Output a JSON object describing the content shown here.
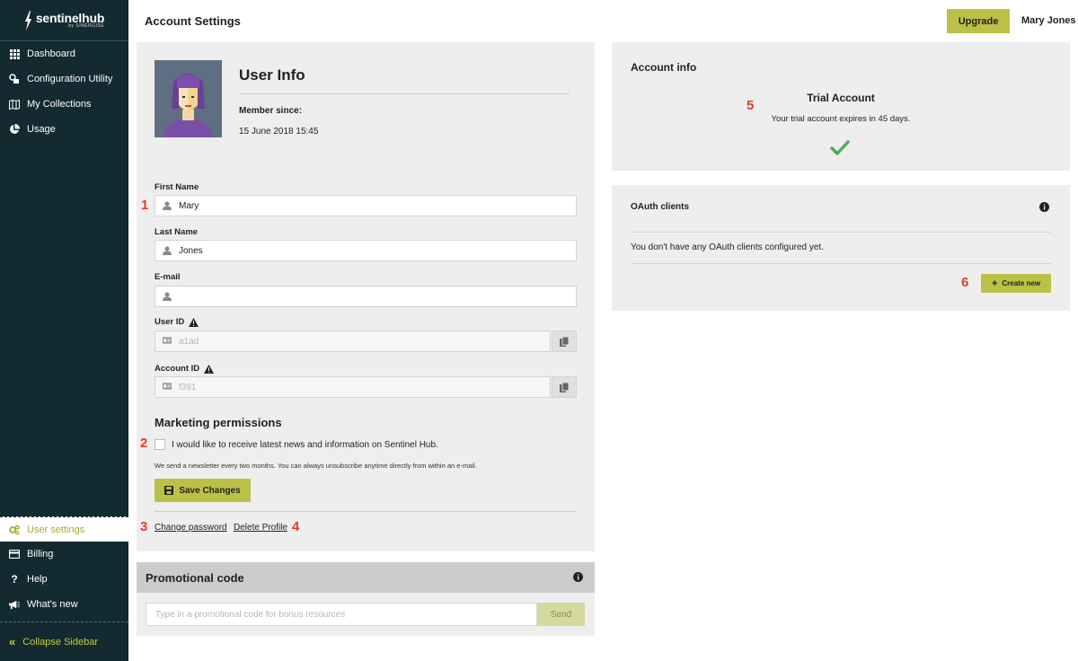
{
  "brand": {
    "name": "sentinelhub",
    "sub": "by SINERGISE"
  },
  "sidebar": {
    "top_items": [
      {
        "label": "Dashboard",
        "icon": "grid-icon"
      },
      {
        "label": "Configuration Utility",
        "icon": "layers-icon"
      },
      {
        "label": "My Collections",
        "icon": "map-icon"
      },
      {
        "label": "Usage",
        "icon": "pie-chart-icon"
      }
    ],
    "bottom_items": [
      {
        "label": "User settings",
        "icon": "gears-icon",
        "active": true
      },
      {
        "label": "Billing",
        "icon": "credit-card-icon"
      },
      {
        "label": "Help",
        "icon": "question-icon"
      },
      {
        "label": "What's new",
        "icon": "megaphone-icon"
      }
    ],
    "collapse_label": "Collapse Sidebar"
  },
  "header": {
    "title": "Account Settings",
    "upgrade_label": "Upgrade",
    "user_name": "Mary Jones"
  },
  "user_info": {
    "title": "User Info",
    "member_since_label": "Member since:",
    "member_since_value": "15 June 2018 15:45",
    "first_name_label": "First Name",
    "first_name_value": "Mary",
    "last_name_label": "Last Name",
    "last_name_value": "Jones",
    "email_label": "E-mail",
    "email_value": "",
    "user_id_label": "User ID",
    "user_id_value": "a1ad",
    "account_id_label": "Account ID",
    "account_id_value": "f391"
  },
  "marketing": {
    "title": "Marketing permissions",
    "checkbox_label": "I would like to receive latest news and information on Sentinel Hub.",
    "note": "We send a newsletter every two months. You can always unsubscribe anytime directly from within an e-mail.",
    "save_label": "Save Changes",
    "change_password_label": "Change password",
    "delete_profile_label": "Delete Profile"
  },
  "promo": {
    "title": "Promotional code",
    "placeholder": "Type in a promotional code for bonus resources",
    "send_label": "Send"
  },
  "account_info": {
    "title": "Account info",
    "trial_title": "Trial Account",
    "trial_text": "Your trial account expires in 45 days."
  },
  "oauth": {
    "title": "OAuth clients",
    "empty_text": "You don't have any OAuth clients configured yet.",
    "create_label": "Create new"
  },
  "annotations": [
    "1",
    "2",
    "3",
    "4",
    "5",
    "6"
  ],
  "colors": {
    "sidebar_bg": "#122a30",
    "accent": "#bcc046",
    "annotation": "#e03a2e",
    "check": "#4caf50"
  }
}
